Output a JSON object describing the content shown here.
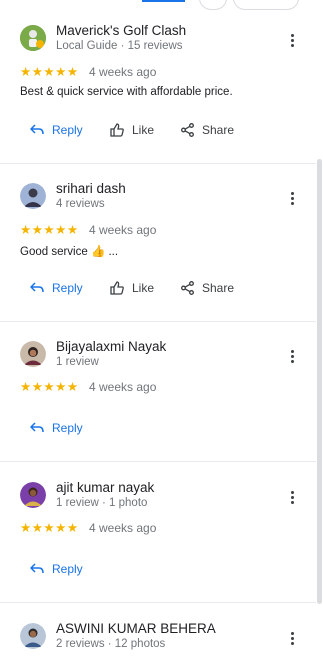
{
  "reviews": [
    {
      "name": "Maverick's Golf Clash",
      "meta": "Local Guide · 15 reviews",
      "stars": "★★★★★",
      "ago": "4 weeks ago",
      "text": "Best & quick service with affordable price.",
      "reply": "Reply",
      "like": "Like",
      "share": "Share"
    },
    {
      "name": "srihari dash",
      "meta": "4 reviews",
      "stars": "★★★★★",
      "ago": "4 weeks ago",
      "text": "Good service 👍 ...",
      "reply": "Reply",
      "like": "Like",
      "share": "Share"
    },
    {
      "name": "Bijayalaxmi Nayak",
      "meta": "1 review",
      "stars": "★★★★★",
      "ago": "4 weeks ago",
      "reply": "Reply"
    },
    {
      "name": "ajit kumar nayak",
      "meta": "1 review · 1 photo",
      "stars": "★★★★★",
      "ago": "4 weeks ago",
      "reply": "Reply"
    },
    {
      "name": "ASWINI KUMAR BEHERA",
      "meta": "2 reviews · 12 photos"
    }
  ],
  "colors": {
    "accent": "#1a73e8",
    "star": "#f4b400",
    "muted": "#70757a"
  }
}
